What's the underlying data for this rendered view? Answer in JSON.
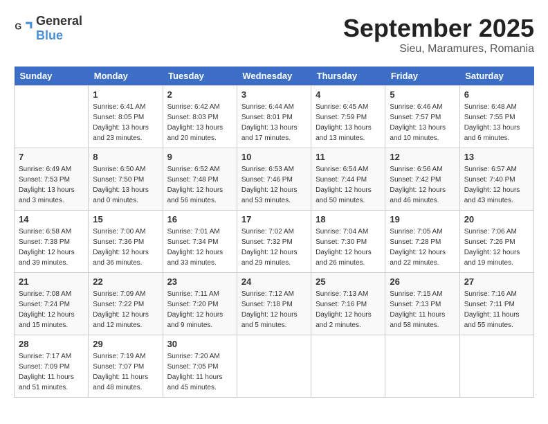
{
  "header": {
    "logo_general": "General",
    "logo_blue": "Blue",
    "month": "September 2025",
    "location": "Sieu, Maramures, Romania"
  },
  "days_of_week": [
    "Sunday",
    "Monday",
    "Tuesday",
    "Wednesday",
    "Thursday",
    "Friday",
    "Saturday"
  ],
  "weeks": [
    [
      {
        "day": "",
        "info": ""
      },
      {
        "day": "1",
        "info": "Sunrise: 6:41 AM\nSunset: 8:05 PM\nDaylight: 13 hours\nand 23 minutes."
      },
      {
        "day": "2",
        "info": "Sunrise: 6:42 AM\nSunset: 8:03 PM\nDaylight: 13 hours\nand 20 minutes."
      },
      {
        "day": "3",
        "info": "Sunrise: 6:44 AM\nSunset: 8:01 PM\nDaylight: 13 hours\nand 17 minutes."
      },
      {
        "day": "4",
        "info": "Sunrise: 6:45 AM\nSunset: 7:59 PM\nDaylight: 13 hours\nand 13 minutes."
      },
      {
        "day": "5",
        "info": "Sunrise: 6:46 AM\nSunset: 7:57 PM\nDaylight: 13 hours\nand 10 minutes."
      },
      {
        "day": "6",
        "info": "Sunrise: 6:48 AM\nSunset: 7:55 PM\nDaylight: 13 hours\nand 6 minutes."
      }
    ],
    [
      {
        "day": "7",
        "info": "Sunrise: 6:49 AM\nSunset: 7:53 PM\nDaylight: 13 hours\nand 3 minutes."
      },
      {
        "day": "8",
        "info": "Sunrise: 6:50 AM\nSunset: 7:50 PM\nDaylight: 13 hours\nand 0 minutes."
      },
      {
        "day": "9",
        "info": "Sunrise: 6:52 AM\nSunset: 7:48 PM\nDaylight: 12 hours\nand 56 minutes."
      },
      {
        "day": "10",
        "info": "Sunrise: 6:53 AM\nSunset: 7:46 PM\nDaylight: 12 hours\nand 53 minutes."
      },
      {
        "day": "11",
        "info": "Sunrise: 6:54 AM\nSunset: 7:44 PM\nDaylight: 12 hours\nand 50 minutes."
      },
      {
        "day": "12",
        "info": "Sunrise: 6:56 AM\nSunset: 7:42 PM\nDaylight: 12 hours\nand 46 minutes."
      },
      {
        "day": "13",
        "info": "Sunrise: 6:57 AM\nSunset: 7:40 PM\nDaylight: 12 hours\nand 43 minutes."
      }
    ],
    [
      {
        "day": "14",
        "info": "Sunrise: 6:58 AM\nSunset: 7:38 PM\nDaylight: 12 hours\nand 39 minutes."
      },
      {
        "day": "15",
        "info": "Sunrise: 7:00 AM\nSunset: 7:36 PM\nDaylight: 12 hours\nand 36 minutes."
      },
      {
        "day": "16",
        "info": "Sunrise: 7:01 AM\nSunset: 7:34 PM\nDaylight: 12 hours\nand 33 minutes."
      },
      {
        "day": "17",
        "info": "Sunrise: 7:02 AM\nSunset: 7:32 PM\nDaylight: 12 hours\nand 29 minutes."
      },
      {
        "day": "18",
        "info": "Sunrise: 7:04 AM\nSunset: 7:30 PM\nDaylight: 12 hours\nand 26 minutes."
      },
      {
        "day": "19",
        "info": "Sunrise: 7:05 AM\nSunset: 7:28 PM\nDaylight: 12 hours\nand 22 minutes."
      },
      {
        "day": "20",
        "info": "Sunrise: 7:06 AM\nSunset: 7:26 PM\nDaylight: 12 hours\nand 19 minutes."
      }
    ],
    [
      {
        "day": "21",
        "info": "Sunrise: 7:08 AM\nSunset: 7:24 PM\nDaylight: 12 hours\nand 15 minutes."
      },
      {
        "day": "22",
        "info": "Sunrise: 7:09 AM\nSunset: 7:22 PM\nDaylight: 12 hours\nand 12 minutes."
      },
      {
        "day": "23",
        "info": "Sunrise: 7:11 AM\nSunset: 7:20 PM\nDaylight: 12 hours\nand 9 minutes."
      },
      {
        "day": "24",
        "info": "Sunrise: 7:12 AM\nSunset: 7:18 PM\nDaylight: 12 hours\nand 5 minutes."
      },
      {
        "day": "25",
        "info": "Sunrise: 7:13 AM\nSunset: 7:16 PM\nDaylight: 12 hours\nand 2 minutes."
      },
      {
        "day": "26",
        "info": "Sunrise: 7:15 AM\nSunset: 7:13 PM\nDaylight: 11 hours\nand 58 minutes."
      },
      {
        "day": "27",
        "info": "Sunrise: 7:16 AM\nSunset: 7:11 PM\nDaylight: 11 hours\nand 55 minutes."
      }
    ],
    [
      {
        "day": "28",
        "info": "Sunrise: 7:17 AM\nSunset: 7:09 PM\nDaylight: 11 hours\nand 51 minutes."
      },
      {
        "day": "29",
        "info": "Sunrise: 7:19 AM\nSunset: 7:07 PM\nDaylight: 11 hours\nand 48 minutes."
      },
      {
        "day": "30",
        "info": "Sunrise: 7:20 AM\nSunset: 7:05 PM\nDaylight: 11 hours\nand 45 minutes."
      },
      {
        "day": "",
        "info": ""
      },
      {
        "day": "",
        "info": ""
      },
      {
        "day": "",
        "info": ""
      },
      {
        "day": "",
        "info": ""
      }
    ]
  ]
}
